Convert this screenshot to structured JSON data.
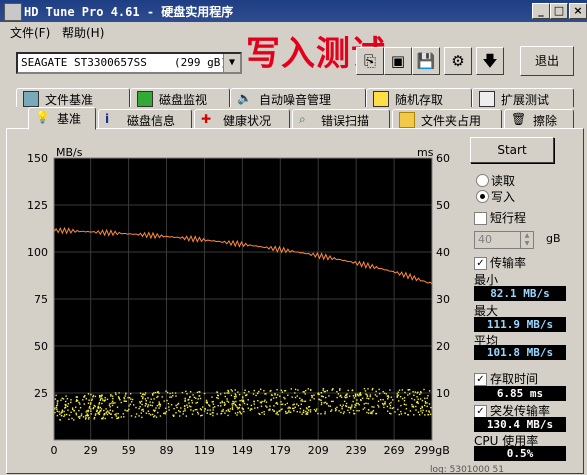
{
  "window": {
    "title": "HD Tune Pro 4.61 - 硬盘实用程序",
    "minimize": "_",
    "maximize": "□",
    "close": "×"
  },
  "menu": {
    "file": "文件(F)",
    "help": "帮助(H)"
  },
  "toolbar": {
    "drive_name": "SEAGATE ST3300657SS",
    "drive_size": "(299 gB)",
    "exit_label": "退出",
    "icons": [
      "temperature-icon",
      "copy-icon",
      "camera-icon",
      "save-icon",
      "settings-icon",
      "download-icon"
    ]
  },
  "overlay_text": "写入测试",
  "tabs_row1": [
    {
      "label": "文件基准",
      "icon": "file-benchmark-icon"
    },
    {
      "label": "磁盘监视",
      "icon": "disk-monitor-icon"
    },
    {
      "label": "自动噪音管理",
      "icon": "speaker-icon"
    },
    {
      "label": "随机存取",
      "icon": "random-access-icon"
    },
    {
      "label": "扩展测试",
      "icon": "extra-tests-icon"
    }
  ],
  "tabs_row2": [
    {
      "label": "基准",
      "icon": "benchmark-icon"
    },
    {
      "label": "磁盘信息",
      "icon": "info-icon"
    },
    {
      "label": "健康状况",
      "icon": "health-icon"
    },
    {
      "label": "错误扫描",
      "icon": "error-scan-icon"
    },
    {
      "label": "文件夹占用",
      "icon": "folder-icon"
    },
    {
      "label": "擦除",
      "icon": "erase-icon"
    }
  ],
  "chart_data": {
    "type": "line",
    "ylabel_left": "MB/s",
    "ylabel_right": "ms",
    "yticks_left": [
      150,
      125,
      100,
      75,
      50,
      25
    ],
    "yticks_right": [
      60,
      50,
      40,
      30,
      20,
      10
    ],
    "ylim_left": [
      0,
      150
    ],
    "ylim_right": [
      0,
      60
    ],
    "xticks": [
      "0",
      "29",
      "59",
      "89",
      "119",
      "149",
      "179",
      "209",
      "239",
      "269",
      "299gB"
    ],
    "xlim": [
      0,
      299
    ],
    "grid": true,
    "series": [
      {
        "axis": "left",
        "color": "#ff8a3c",
        "x": [
          0,
          10,
          20,
          30,
          40,
          50,
          60,
          70,
          80,
          90,
          100,
          110,
          120,
          130,
          140,
          150,
          160,
          170,
          180,
          190,
          200,
          210,
          220,
          230,
          240,
          250,
          260,
          270,
          280,
          290,
          299
        ],
        "values": [
          111.5,
          111.3,
          111.0,
          110.7,
          110.3,
          110.0,
          109.6,
          109.2,
          108.7,
          108.2,
          107.6,
          107.0,
          106.3,
          105.6,
          104.8,
          104.0,
          103.1,
          102.2,
          101.2,
          100.2,
          99.1,
          98.0,
          96.7,
          95.4,
          94.0,
          92.5,
          90.9,
          89.2,
          87.3,
          85.0,
          83.0
        ]
      },
      {
        "axis": "right",
        "color": "#f5ef3a",
        "style": "scatter",
        "x": [
          0,
          30,
          60,
          90,
          120,
          150,
          180,
          210,
          240,
          270,
          299
        ],
        "values": [
          7.0,
          7.3,
          7.6,
          7.8,
          8.0,
          8.2,
          8.3,
          8.4,
          8.4,
          8.3,
          8.2
        ]
      }
    ]
  },
  "controls": {
    "start": "Start",
    "read": "读取",
    "write": "写入",
    "short_stroke": "短行程",
    "short_stroke_value": "40",
    "short_stroke_unit": "gB",
    "transfer_rate": "传输率",
    "min_label": "最小",
    "min_value": "82.1 MB/s",
    "max_label": "最大",
    "max_value": "111.9 MB/s",
    "avg_label": "平均",
    "avg_value": "101.8 MB/s",
    "access_time": "存取时间",
    "access_value": "6.85 ms",
    "burst_rate": "突发传输率",
    "burst_value": "130.4 MB/s",
    "cpu_label": "CPU 使用率",
    "cpu_value": "0.5%"
  },
  "footer_text": "log: 5301000 51"
}
